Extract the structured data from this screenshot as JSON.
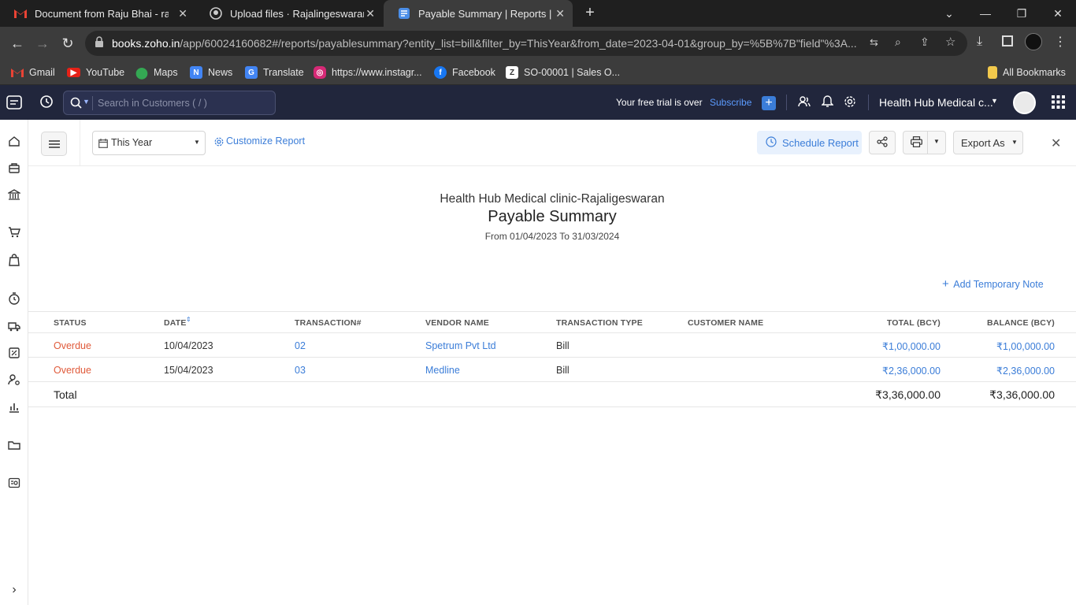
{
  "browser": {
    "tabs": [
      {
        "title": "Document from Raju Bhai - raja",
        "icon": "gmail-icon"
      },
      {
        "title": "Upload files · Rajalingeswaran/H",
        "icon": "github-icon"
      },
      {
        "title": "Payable Summary | Reports | Zoh",
        "icon": "zoho-books-icon"
      }
    ],
    "url_host": "books.zoho.in",
    "url_path": "/app/60024160682#/reports/payablesummary?entity_list=bill&filter_by=ThisYear&from_date=2023-04-01&group_by=%5B%7B\"field\"%3A...",
    "bookmarks": [
      "Gmail",
      "YouTube",
      "Maps",
      "News",
      "Translate",
      "https://www.instagr...",
      "Facebook",
      "SO-00001 | Sales O..."
    ],
    "all_bookmarks": "All Bookmarks"
  },
  "appbar": {
    "search_placeholder": "Search in Customers ( / )",
    "trial_text": "Your free trial is over",
    "subscribe": "Subscribe",
    "org_name": "Health Hub Medical c...",
    "accent": "#3b7dd8"
  },
  "toolbar": {
    "period": "This Year",
    "customize": "Customize Report",
    "schedule": "Schedule Report",
    "export": "Export As"
  },
  "report": {
    "org": "Health Hub Medical clinic-Rajaligeswaran",
    "title": "Payable Summary",
    "range": "From 01/04/2023 To 31/03/2024",
    "add_note": "Add Temporary Note",
    "columns": [
      "STATUS",
      "DATE",
      "TRANSACTION#",
      "VENDOR NAME",
      "TRANSACTION TYPE",
      "CUSTOMER NAME",
      "TOTAL (BCY)",
      "BALANCE (BCY)"
    ],
    "rows": [
      {
        "status": "Overdue",
        "date": "10/04/2023",
        "txn": "02",
        "vendor": "Spetrum Pvt Ltd",
        "type": "Bill",
        "customer": "",
        "total": "₹1,00,000.00",
        "balance": "₹1,00,000.00"
      },
      {
        "status": "Overdue",
        "date": "15/04/2023",
        "txn": "03",
        "vendor": "Medline",
        "type": "Bill",
        "customer": "",
        "total": "₹2,36,000.00",
        "balance": "₹2,36,000.00"
      }
    ],
    "total_label": "Total",
    "total_total": "₹3,36,000.00",
    "total_balance": "₹3,36,000.00"
  }
}
